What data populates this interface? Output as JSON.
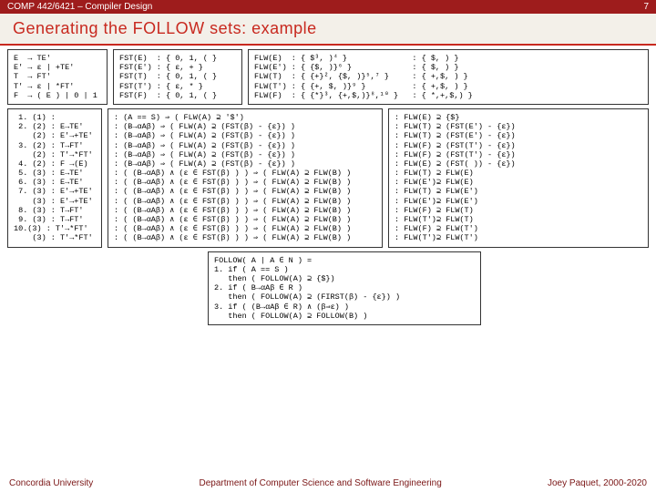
{
  "header": {
    "course": "COMP 442/6421 – Compiler Design",
    "page_num": "7"
  },
  "title": "Generating the FOLLOW sets: example",
  "grammar": "E  → TE'\nE' → ε | +TE'\nT  → FT'\nT' → ε | *FT'\nF  → ( E ) | 0 | 1",
  "fst": "FST(E)  : { 0, 1, ( }\nFST(E') : { ε, + }\nFST(T)  : { 0, 1, ( }\nFST(T') : { ε, * }\nFST(F)  : { 0, 1, ( }",
  "flw": "FLW(E)  : { $³, )⁴ }              : { $, ) }\nFLW(E') : { {$, )}⁶ }             : { $, ) }\nFLW(T)  : { {+}², {$, )}⁵,⁷ }     : { +,$, ) }\nFLW(T') : { {+, $, )}⁹ }          : { +,$, ) }\nFLW(F)  : { {*}³, {+,$,)}⁸,¹⁰ }   : { *,+,$,) }",
  "steps": " 1. (1) : \n 2. (2) : E→TE'\n    (2) : E'→+TE'\n 3. (2) : T→FT'\n    (2) : T'→*FT'\n 4. (2) : F →(E)\n 5. (3) : E→TE'\n 6. (3) : E→TE'\n 7. (3) : E'→+TE'\n    (3) : E'→+TE'\n 8. (3) : T→FT'\n 9. (3) : T→FT'\n10.(3) : T'→*FT'\n    (3) : T'→*FT'",
  "derive": ": (A == S) ⇒ ( FLW(A) ⊇ '$')\n: (B→αAβ) ⇒ ( FLW(A) ⊇ (FST(β) - {ε}) )\n: (B→αAβ) ⇒ ( FLW(A) ⊇ (FST(β) - {ε}) )\n: (B→αAβ) ⇒ ( FLW(A) ⊇ (FST(β) - {ε}) )\n: (B→αAβ) ⇒ ( FLW(A) ⊇ (FST(β) - {ε}) )\n: (B→αAβ) ⇒ ( FLW(A) ⊇ (FST(β) - {ε}) )\n: ( (B→αAβ) ∧ (ε ∈ FST(β) ) ) ⇒ ( FLW(A) ⊇ FLW(B) )\n: ( (B→αAβ) ∧ (ε ∈ FST(β) ) ) ⇒ ( FLW(A) ⊇ FLW(B) )\n: ( (B→αAβ) ∧ (ε ∈ FST(β) ) ) ⇒ ( FLW(A) ⊇ FLW(B) )\n: ( (B→αAβ) ∧ (ε ∈ FST(β) ) ) ⇒ ( FLW(A) ⊇ FLW(B) )\n: ( (B→αAβ) ∧ (ε ∈ FST(β) ) ) ⇒ ( FLW(A) ⊇ FLW(B) )\n: ( (B→αAβ) ∧ (ε ∈ FST(β) ) ) ⇒ ( FLW(A) ⊇ FLW(B) )\n: ( (B→αAβ) ∧ (ε ∈ FST(β) ) ) ⇒ ( FLW(A) ⊇ FLW(B) )\n: ( (B→αAβ) ∧ (ε ∈ FST(β) ) ) ⇒ ( FLW(A) ⊇ FLW(B) )",
  "result": ": FLW(E) ⊇ {$}\n: FLW(T) ⊇ (FST(E') - {ε})\n: FLW(T) ⊇ (FST(E') - {ε})\n: FLW(F) ⊇ (FST(T') - {ε})\n: FLW(F) ⊇ (FST(T') - {ε})\n: FLW(E) ⊇ (FST( )) - {ε})\n: FLW(T) ⊇ FLW(E)\n: FLW(E')⊇ FLW(E)\n: FLW(T) ⊇ FLW(E')\n: FLW(E')⊇ FLW(E')\n: FLW(F) ⊇ FLW(T)\n: FLW(T')⊇ FLW(T)\n: FLW(F) ⊇ FLW(T')\n: FLW(T')⊇ FLW(T')",
  "algo": "FOLLOW( A | A ∈ N ) =\n1. if ( A == S )\n   then ( FOLLOW(A) ⊇ {$})\n2. if ( B→αAβ ∈ R )\n   then ( FOLLOW(A) ⊇ (FIRST(β) - {ε}) )\n3. if ( (B→αAβ ∈ R) ∧ (β⇒ε) )\n   then ( FOLLOW(A) ⊇ FOLLOW(B) )",
  "footer": {
    "left": "Concordia University",
    "center": "Department of Computer Science and Software Engineering",
    "right": "Joey Paquet, 2000-2020"
  }
}
